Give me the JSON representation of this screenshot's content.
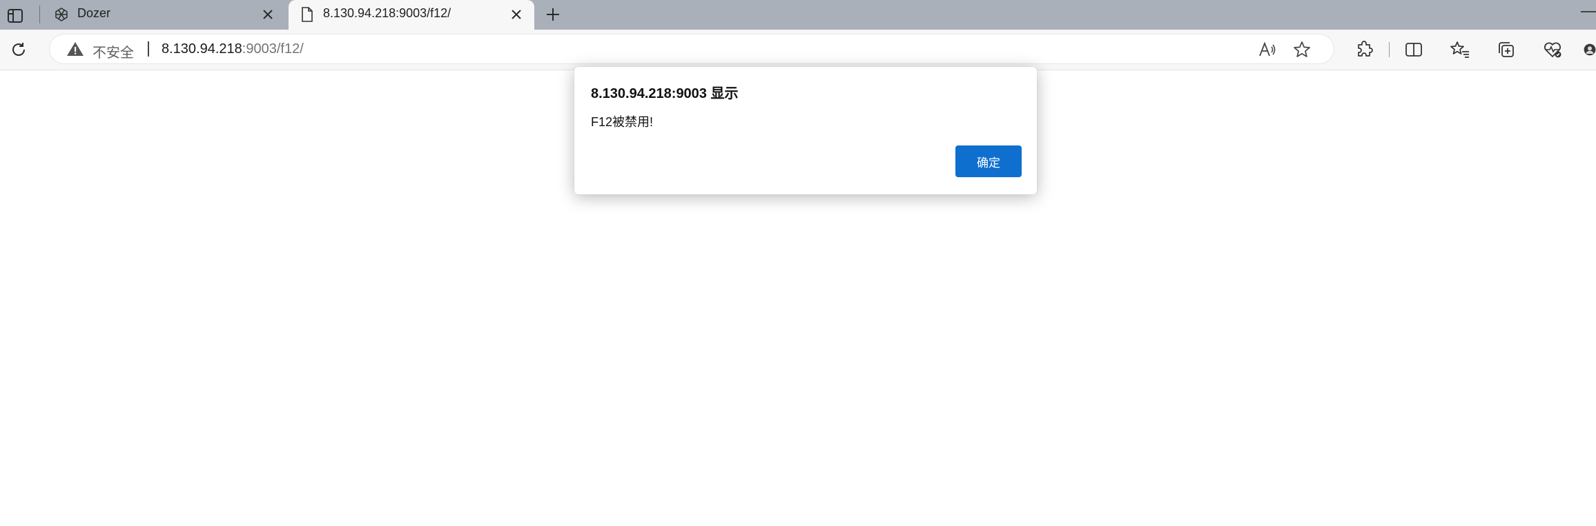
{
  "tabs": [
    {
      "title": "Dozer",
      "favicon": "dozer-logo-icon"
    },
    {
      "title": "8.130.94.218:9003/f12/",
      "favicon": "page-icon",
      "active": true
    }
  ],
  "address_bar": {
    "security_label": "不安全",
    "url_host": "8.130.94.218",
    "url_rest": ":9003/f12/"
  },
  "dialog": {
    "title": "8.130.94.218:9003 显示",
    "message": "F12被禁用!",
    "ok_label": "确定"
  },
  "colors": {
    "tabbar": "#a9b0b9",
    "accent": "#0f6fcf"
  }
}
